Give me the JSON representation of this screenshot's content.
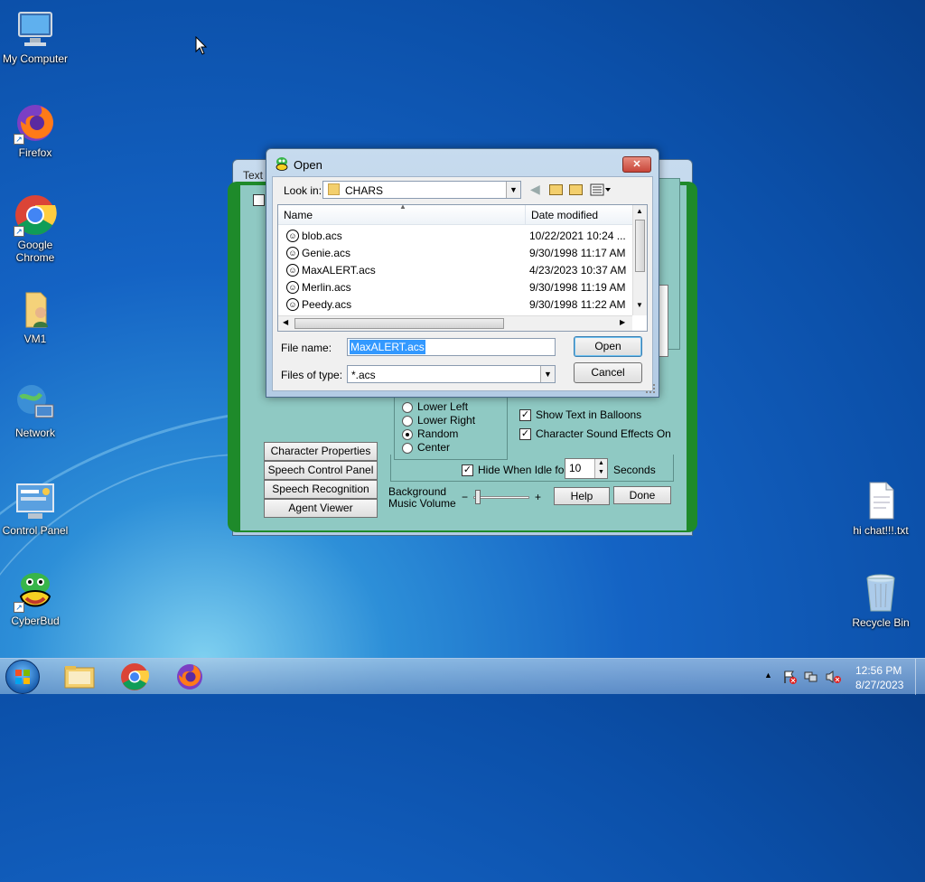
{
  "desktop": {
    "icons": [
      {
        "label": "My Computer",
        "icon": "computer-icon"
      },
      {
        "label": "Firefox",
        "icon": "firefox-icon"
      },
      {
        "label": "Google Chrome",
        "icon": "chrome-icon"
      },
      {
        "label": "VM1",
        "icon": "user-folder-icon"
      },
      {
        "label": "Network",
        "icon": "network-icon"
      },
      {
        "label": "Control Panel",
        "icon": "control-panel-icon"
      },
      {
        "label": "CyberBud",
        "icon": "cyberbud-icon"
      },
      {
        "label": "hi chat!!!.txt",
        "icon": "text-file-icon"
      },
      {
        "label": "Recycle Bin",
        "icon": "recycle-bin-icon"
      }
    ]
  },
  "agent_window": {
    "title_partial": "Text",
    "side_buttons": [
      "Character Properties",
      "Speech Control Panel",
      "Speech Recognition",
      "Agent Viewer"
    ],
    "positions": [
      "Lower Left",
      "Lower Right",
      "Random",
      "Center"
    ],
    "selected_position": "Random",
    "show_balloons": "Show Text in Balloons",
    "sound_effects": "Character Sound Effects On",
    "hide_idle": "Hide When Idle for",
    "idle_value": "10",
    "seconds": "Seconds",
    "bg_music_1": "Background",
    "bg_music_2": "Music Volume",
    "minus": "−",
    "plus": "+",
    "help": "Help",
    "done": "Done"
  },
  "open_dialog": {
    "title": "Open",
    "look_in_label": "Look in:",
    "look_in_value": "CHARS",
    "col_name": "Name",
    "col_date": "Date modified",
    "files": [
      {
        "name": "blob.acs",
        "date": "10/22/2021 10:24 ..."
      },
      {
        "name": "Genie.acs",
        "date": "9/30/1998 11:17 AM"
      },
      {
        "name": "MaxALERT.acs",
        "date": "4/23/2023 10:37 AM"
      },
      {
        "name": "Merlin.acs",
        "date": "9/30/1998 11:19 AM"
      },
      {
        "name": "Peedy.acs",
        "date": "9/30/1998 11:22 AM"
      }
    ],
    "file_name_label": "File name:",
    "file_name_value": "MaxALERT.acs",
    "files_of_type_label": "Files of type:",
    "files_of_type_value": "*.acs",
    "open_button": "Open",
    "cancel_button": "Cancel",
    "close_glyph": "✕"
  },
  "taskbar": {
    "time": "12:56 PM",
    "date": "8/27/2023",
    "tray_arrow": "▲"
  },
  "colors": {
    "agent_panel": "#8fc9c3",
    "agent_border": "#1e8a2a",
    "selection": "#3399ff",
    "close_red": "#c8463a"
  }
}
